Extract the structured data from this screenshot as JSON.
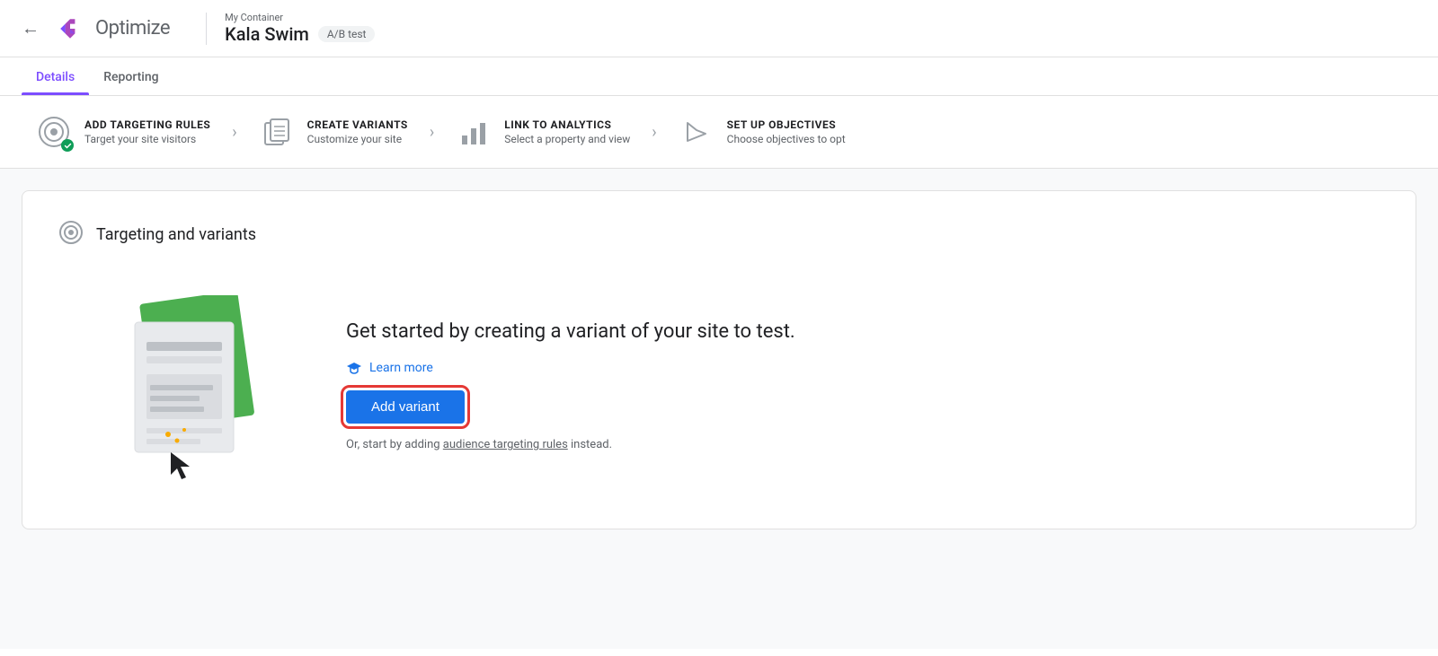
{
  "header": {
    "back_label": "←",
    "logo_text": "Optimize",
    "container_label": "My Container",
    "experiment_name": "Kala Swim",
    "experiment_badge": "A/B test"
  },
  "tabs": [
    {
      "id": "details",
      "label": "Details",
      "active": true
    },
    {
      "id": "reporting",
      "label": "Reporting",
      "active": false
    }
  ],
  "steps": [
    {
      "id": "targeting",
      "title": "ADD TARGETING RULES",
      "subtitle": "Target your site visitors",
      "has_check": true
    },
    {
      "id": "variants",
      "title": "CREATE VARIANTS",
      "subtitle": "Customize your site"
    },
    {
      "id": "analytics",
      "title": "LINK TO ANALYTICS",
      "subtitle": "Select a property and view"
    },
    {
      "id": "objectives",
      "title": "SET UP OBJECTIVES",
      "subtitle": "Choose objectives to opt"
    }
  ],
  "card": {
    "title": "Targeting and variants"
  },
  "promo": {
    "text": "Get started by creating a variant of your site to test.",
    "learn_more_label": "Learn more",
    "add_variant_label": "Add variant",
    "alt_text_prefix": "Or, start by adding ",
    "alt_text_link": "audience targeting rules",
    "alt_text_suffix": " instead."
  }
}
